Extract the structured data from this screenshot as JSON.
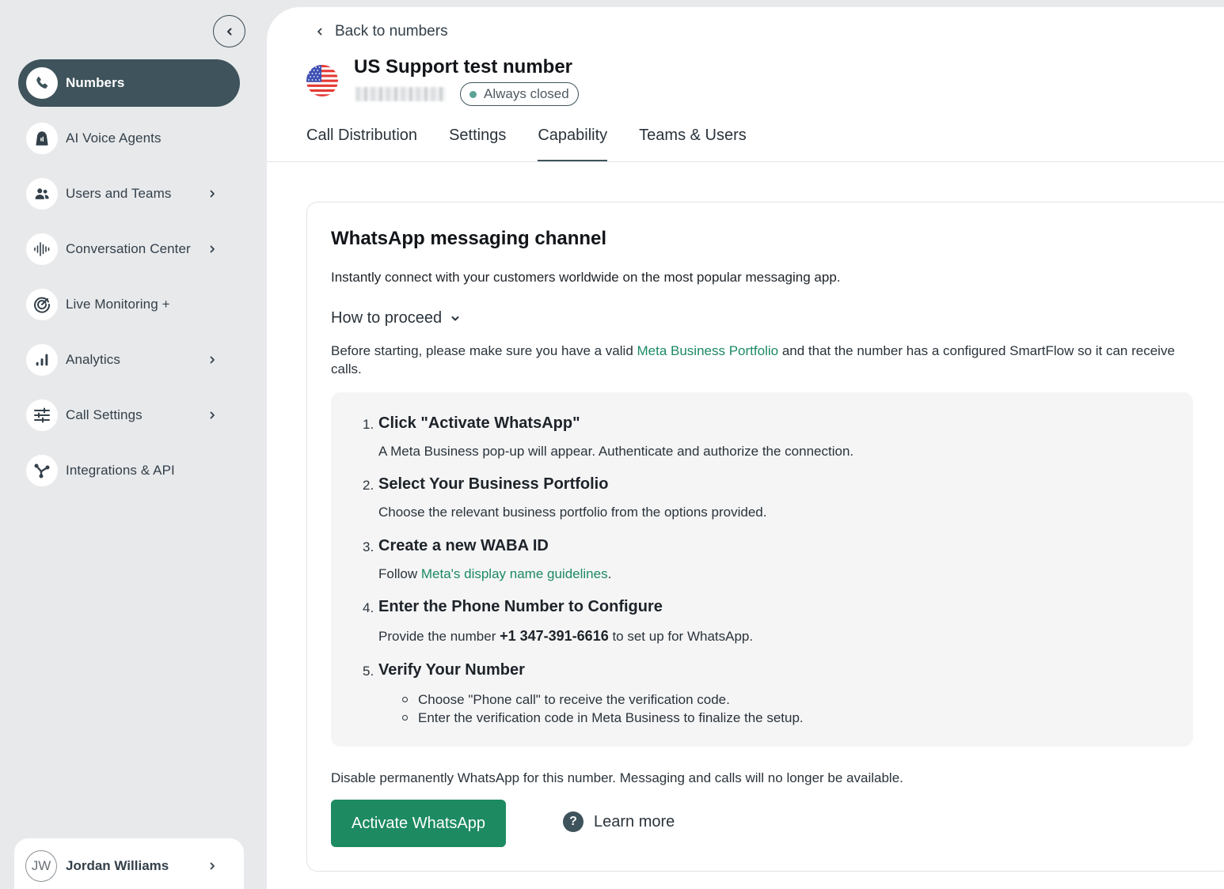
{
  "sidebar": {
    "items": [
      {
        "label": "Numbers",
        "icon": "phone-icon",
        "has_chevron": false,
        "active": true
      },
      {
        "label": "AI Voice Agents",
        "icon": "ai-agent-icon",
        "has_chevron": false
      },
      {
        "label": "Users and Teams",
        "icon": "users-icon",
        "has_chevron": true
      },
      {
        "label": "Conversation Center",
        "icon": "waveform-icon",
        "has_chevron": true
      },
      {
        "label": "Live Monitoring +",
        "icon": "monitoring-icon",
        "has_chevron": false
      },
      {
        "label": "Analytics",
        "icon": "bar-chart-icon",
        "has_chevron": true
      },
      {
        "label": "Call Settings",
        "icon": "sliders-icon",
        "has_chevron": true
      },
      {
        "label": "Integrations & API",
        "icon": "integration-icon",
        "has_chevron": false
      }
    ],
    "user": {
      "initials": "JW",
      "name": "Jordan Williams"
    }
  },
  "header": {
    "back_label": "Back to numbers",
    "title": "US Support test number",
    "status": "Always closed",
    "tabs": [
      {
        "label": "Call Distribution",
        "active": false
      },
      {
        "label": "Settings",
        "active": false
      },
      {
        "label": "Capability",
        "active": true
      },
      {
        "label": "Teams & Users",
        "active": false
      }
    ]
  },
  "card": {
    "title": "WhatsApp messaging channel",
    "subtitle": "Instantly connect with your customers worldwide on the most popular messaging app.",
    "how_to_proceed": "How to proceed",
    "intro_before": "Before starting, please make sure you have a valid ",
    "intro_link": "Meta Business Portfolio",
    "intro_after": " and that the number has a configured SmartFlow so it can receive calls.",
    "steps": [
      {
        "num": "1.",
        "title": "Click \"Activate WhatsApp\"",
        "desc": "A Meta Business pop-up will appear. Authenticate and authorize the connection."
      },
      {
        "num": "2.",
        "title": "Select Your Business Portfolio",
        "desc": "Choose the relevant business portfolio from the options provided."
      },
      {
        "num": "3.",
        "title": "Create a new WABA ID",
        "desc_before": "Follow ",
        "desc_link": "Meta's display name guidelines",
        "desc_after": "."
      },
      {
        "num": "4.",
        "title": "Enter the Phone Number to Configure",
        "desc_before": "Provide the number ",
        "desc_number": "+1 347-391-6616",
        "desc_after": " to set up for WhatsApp."
      },
      {
        "num": "5.",
        "title": "Verify Your Number",
        "sub_items": [
          "Choose \"Phone call\" to receive the verification code.",
          "Enter the verification code in Meta Business to finalize the setup."
        ]
      }
    ],
    "disable_text": "Disable permanently WhatsApp for this number. Messaging and calls will no longer be available.",
    "activate_button": "Activate WhatsApp",
    "learn_more": "Learn more"
  },
  "colors": {
    "accent_green": "#1d8a62",
    "sidebar_active": "#3e535b",
    "status_dot": "#5ba394"
  }
}
